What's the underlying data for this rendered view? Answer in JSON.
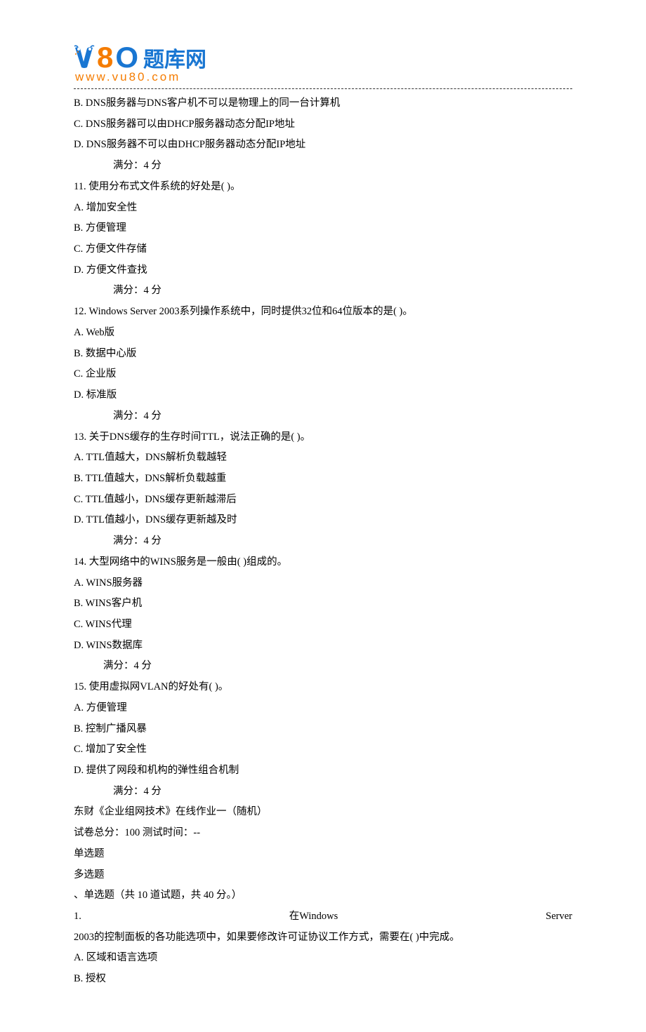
{
  "logo": {
    "big8": "8",
    "bigO": "O",
    "text": "题库网",
    "url": "www.vu80.com"
  },
  "lines": {
    "optB_prev": "B. DNS服务器与DNS客户机不可以是物理上的同一台计算机",
    "optC_prev": "C. DNS服务器可以由DHCP服务器动态分配IP地址",
    "optD_prev": "D. DNS服务器不可以由DHCP服务器动态分配IP地址",
    "score_4": "满分：4  分",
    "q11": "11.  使用分布式文件系统的好处是( )。",
    "q11A": "A. 增加安全性",
    "q11B": "B. 方便管理",
    "q11C": "C. 方便文件存储",
    "q11D": "D. 方便文件查找",
    "q12": "12.  Windows Server 2003系列操作系统中，同时提供32位和64位版本的是( )。",
    "q12A": "A. Web版",
    "q12B": "B. 数据中心版",
    "q12C": "C. 企业版",
    "q12D": "D. 标准版",
    "q13": "13.  关于DNS缓存的生存时间TTL，说法正确的是( )。",
    "q13A": "A. TTL值越大，DNS解析负载越轻",
    "q13B": "B. TTL值越大，DNS解析负载越重",
    "q13C": "C. TTL值越小，DNS缓存更新越滞后",
    "q13D": "D. TTL值越小，DNS缓存更新越及时",
    "q14": "14.  大型网络中的WINS服务是一般由( )组成的。",
    "q14A": "A. WINS服务器",
    "q14B": "B. WINS客户机",
    "q14C": "C. WINS代理",
    "q14D": "D. WINS数据库",
    "q15": "15.  使用虚拟网VLAN的好处有( )。",
    "q15A": "A. 方便管理",
    "q15B": "B. 控制广播风暴",
    "q15C": "C. 增加了安全性",
    "q15D": "D. 提供了网段和机构的弹性组合机制",
    "title2": "东财《企业组网技术》在线作业一（随机）",
    "info2": "试卷总分：100       测试时间：--",
    "section_single": "单选题",
    "section_multi": "多选题",
    "section_header": "、单选题（共 10 道试题，共 40 分。）",
    "q1_left": "1.",
    "q1_mid": "在Windows",
    "q1_right": "Server",
    "q1_cont": "2003的控制面板的各功能选项中，如果要修改许可证协议工作方式，需要在( )中完成。",
    "q1A": "A. 区域和语言选项",
    "q1B": "B. 授权"
  }
}
